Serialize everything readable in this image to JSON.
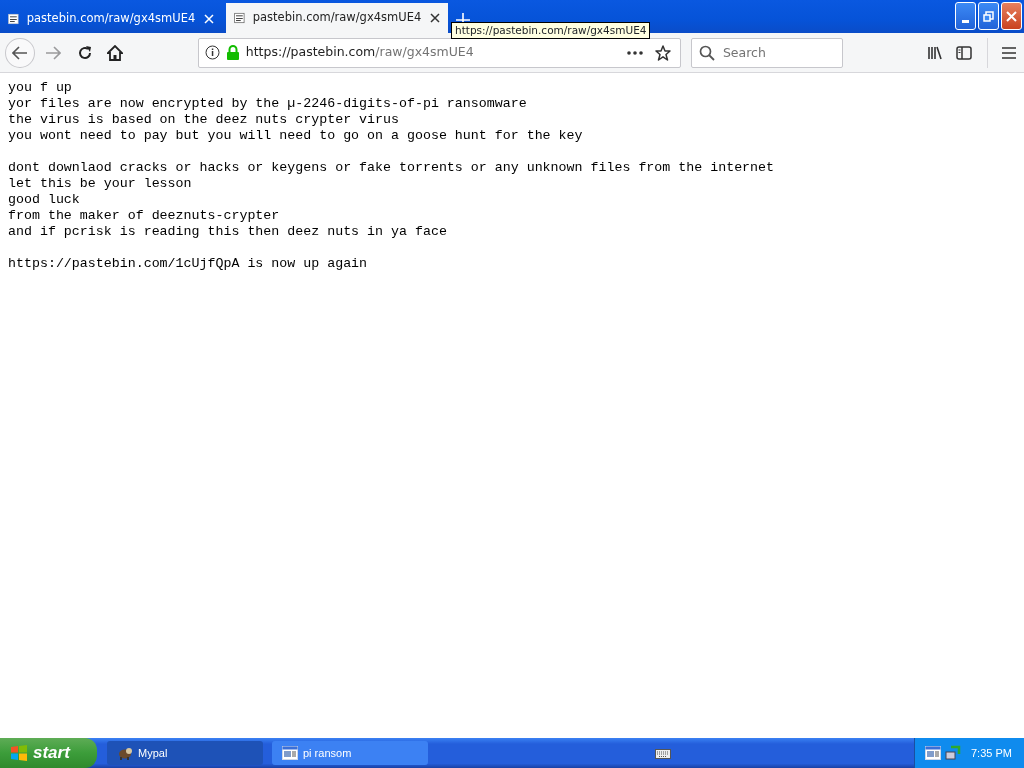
{
  "tabs": [
    {
      "label": "pastebin.com/raw/gx4smUE4",
      "selected": false
    },
    {
      "label": "pastebin.com/raw/gx4smUE4",
      "selected": true
    }
  ],
  "tooltip": "https://pastebin.com/raw/gx4smUE4",
  "toolbar": {
    "back_disabled": false,
    "forward_disabled": true,
    "url_host": "https://pastebin.com",
    "url_path": "/raw/gx4smUE4",
    "search_placeholder": "Search"
  },
  "content": [
    {
      "lines": [
        "you f up",
        "yor files are now encrypted by the µ-2246-digits-of-pi ransomware",
        "the virus is based on the deez nuts crypter virus",
        "you wont need to pay but you will need to go on a goose hunt for the key"
      ]
    },
    {
      "lines": [
        "dont downlaod cracks or hacks or keygens or fake torrents or any unknown files from the internet",
        "let this be your lesson",
        "good luck",
        "from the maker of deeznuts-crypter",
        "and if pcrisk is reading this then deez nuts in ya face"
      ]
    },
    {
      "lines": [
        "https://pastebin.com/1cUjfQpA is now up again"
      ]
    }
  ],
  "taskbar": {
    "start": "start",
    "tasks": [
      {
        "label": "Mypal",
        "selected": true,
        "kind": "browser"
      },
      {
        "label": "pi ransom",
        "selected": false,
        "kind": "window"
      }
    ],
    "clock": "7:35 PM"
  }
}
